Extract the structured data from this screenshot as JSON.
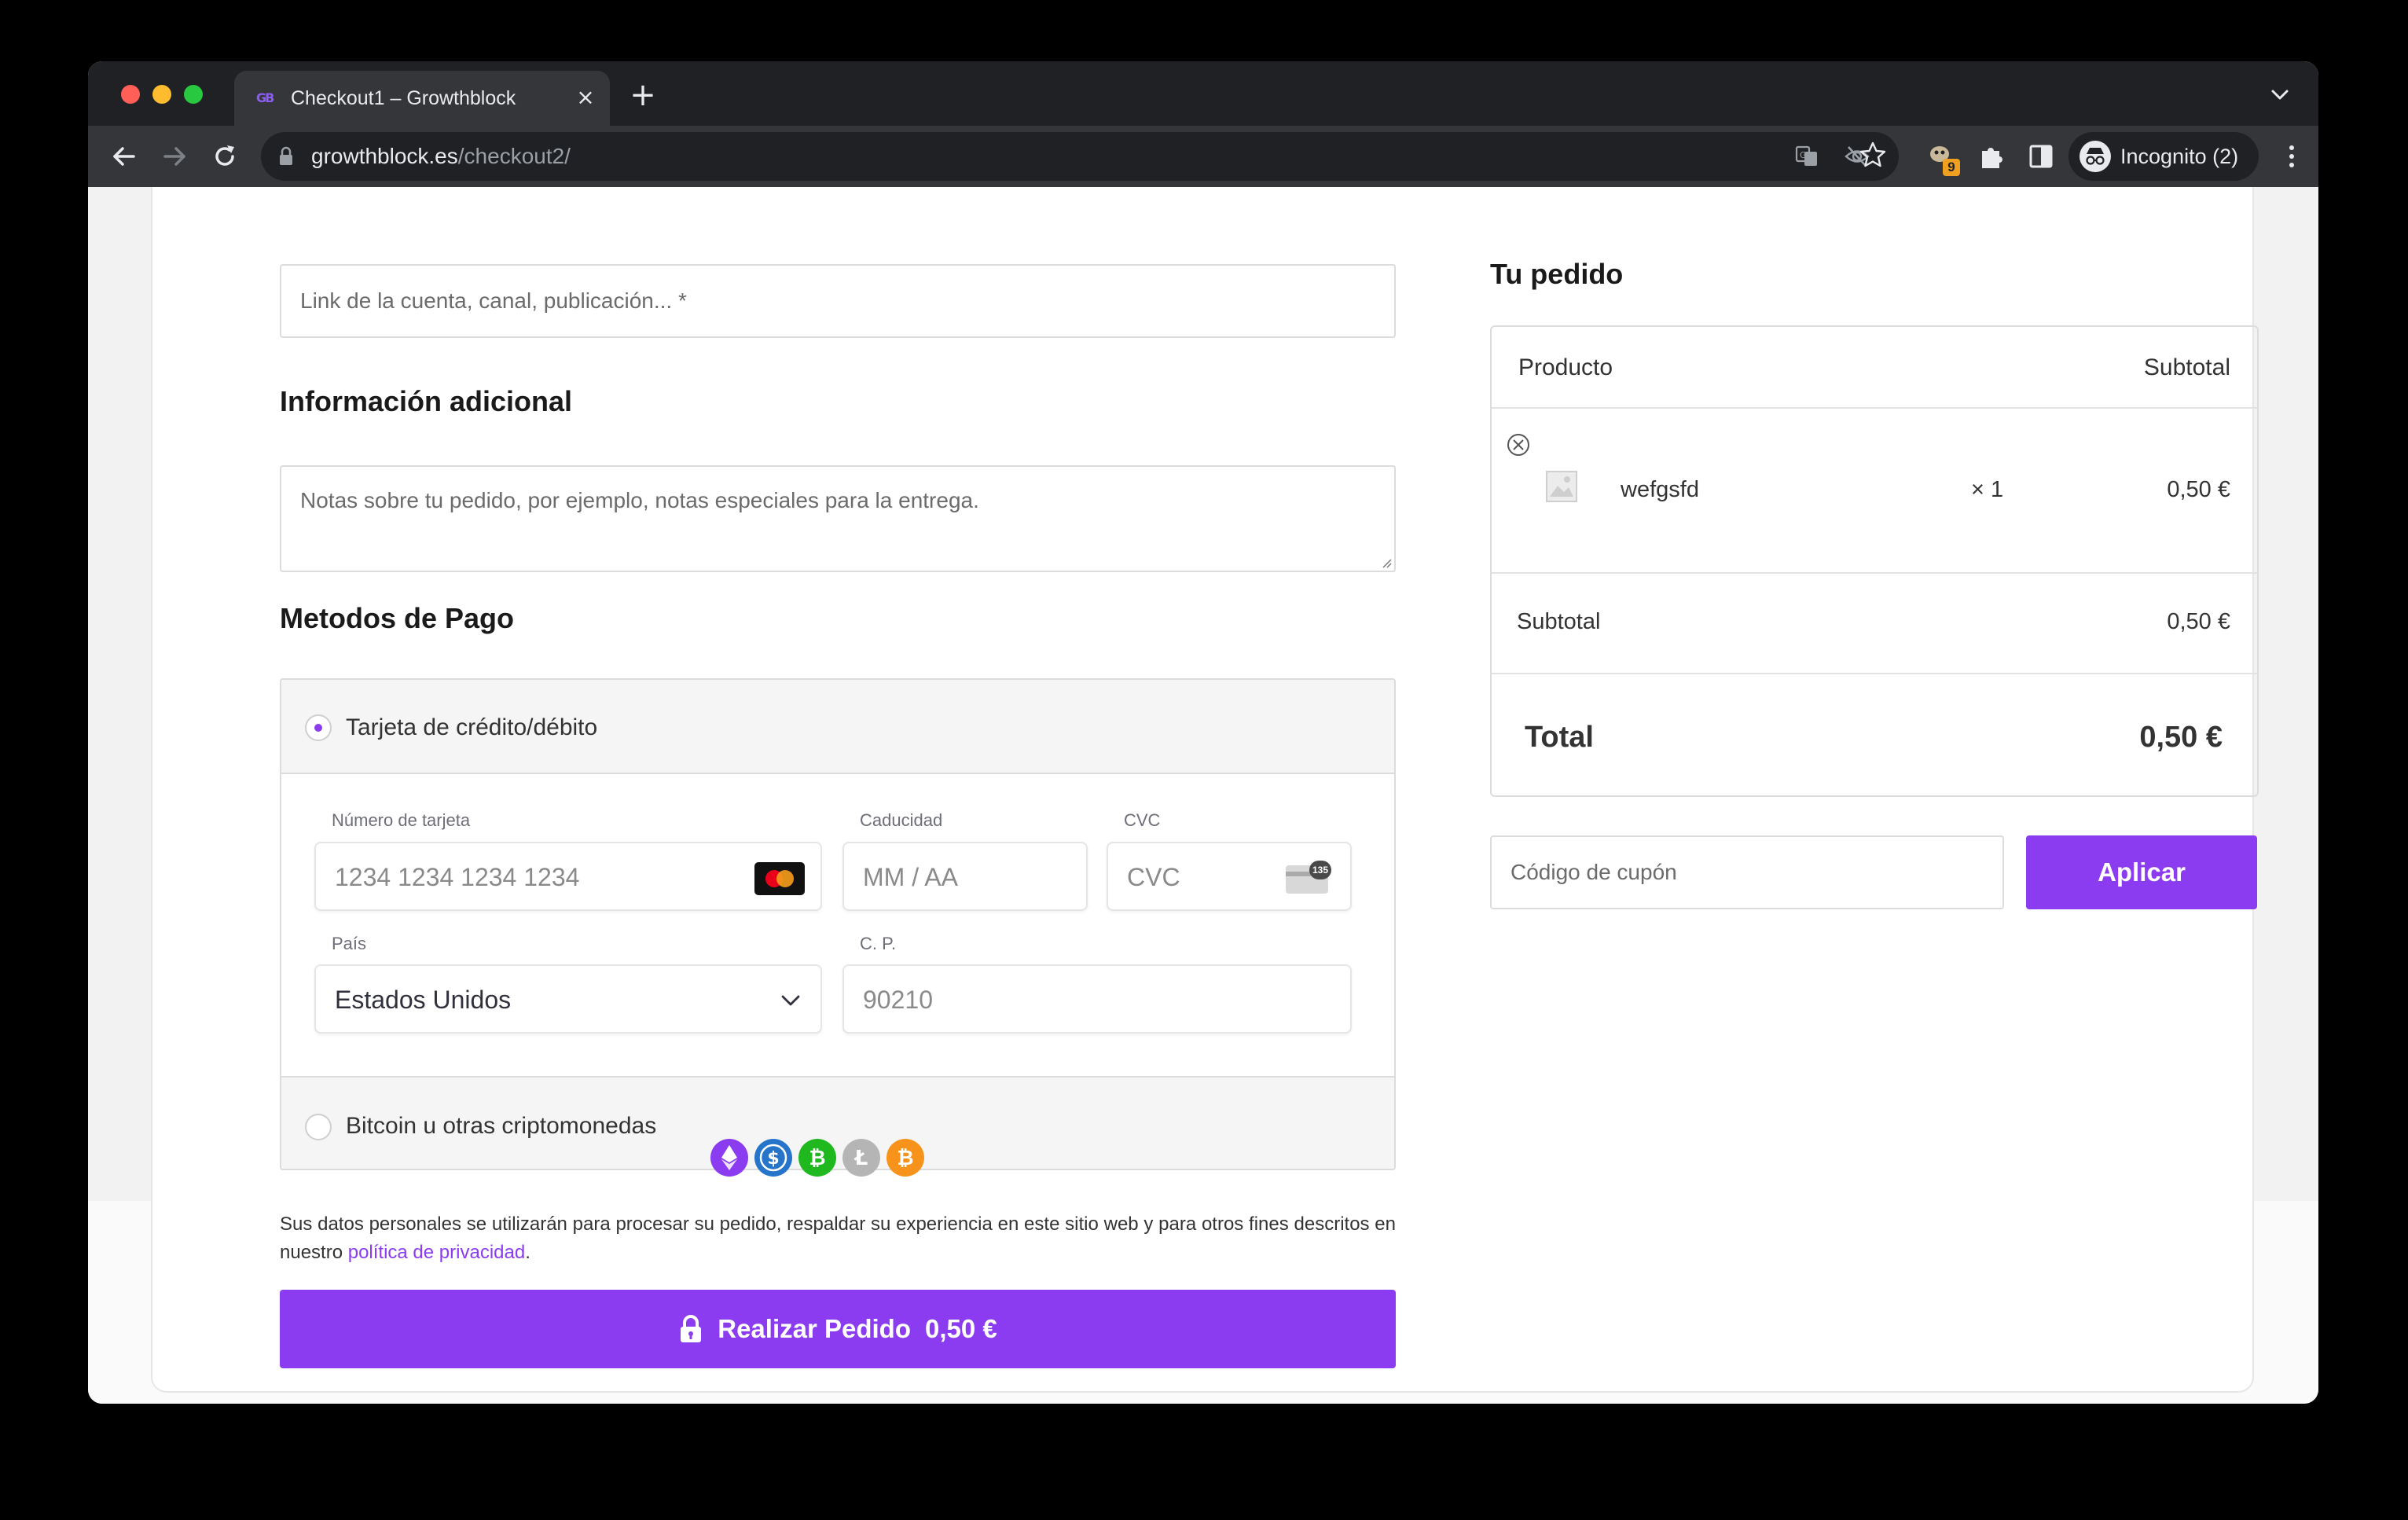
{
  "browser": {
    "tab_title": "Checkout1 – Growthblock",
    "tab_favicon_text": "GB",
    "tab_close": "×",
    "new_tab": "+",
    "url_domain": "growthblock.es",
    "url_path": "/checkout2/",
    "extension_badge": "9",
    "profile_label": "Incognito (2)"
  },
  "form": {
    "link_placeholder": "Link de la cuenta, canal, publicación... *",
    "additional_info_heading": "Información adicional",
    "notes_placeholder": "Notas sobre tu pedido, por ejemplo, notas especiales para la entrega.",
    "payment_heading": "Metodos de Pago",
    "card_option_label": "Tarjeta de crédito/débito",
    "card_number_label": "Número de tarjeta",
    "card_number_placeholder": "1234 1234 1234 1234",
    "expiry_label": "Caducidad",
    "expiry_placeholder": "MM / AA",
    "cvc_label": "CVC",
    "cvc_placeholder": "CVC",
    "cvc_badge": "135",
    "country_label": "País",
    "country_value": "Estados Unidos",
    "postal_label": "C. P.",
    "postal_placeholder": "90210",
    "crypto_option_label": "Bitcoin u otras criptomonedas",
    "privacy_text_prefix": "Sus datos personales se utilizarán para procesar su pedido, respaldar su experiencia en este sitio web y para otros fines descritos en nuestro ",
    "privacy_link": "política de privacidad",
    "privacy_suffix": ".",
    "place_order_label": "Realizar Pedido",
    "place_order_amount": "0,50 €"
  },
  "order": {
    "heading": "Tu pedido",
    "col_product": "Producto",
    "col_subtotal": "Subtotal",
    "item_name": "wefgsfd",
    "item_qty": "× 1",
    "item_price": "0,50 €",
    "subtotal_label": "Subtotal",
    "subtotal_value": "0,50 €",
    "total_label": "Total",
    "total_value": "0,50 €",
    "coupon_placeholder": "Código de cupón",
    "apply_label": "Aplicar"
  },
  "crypto_icons": [
    "ethereum-icon",
    "usd-coin-icon",
    "bitcoin-cash-icon",
    "litecoin-icon",
    "bitcoin-icon"
  ],
  "colors": {
    "accent": "#8b3cf0",
    "chrome_dark": "#202124",
    "chrome_tab": "#35363a"
  }
}
